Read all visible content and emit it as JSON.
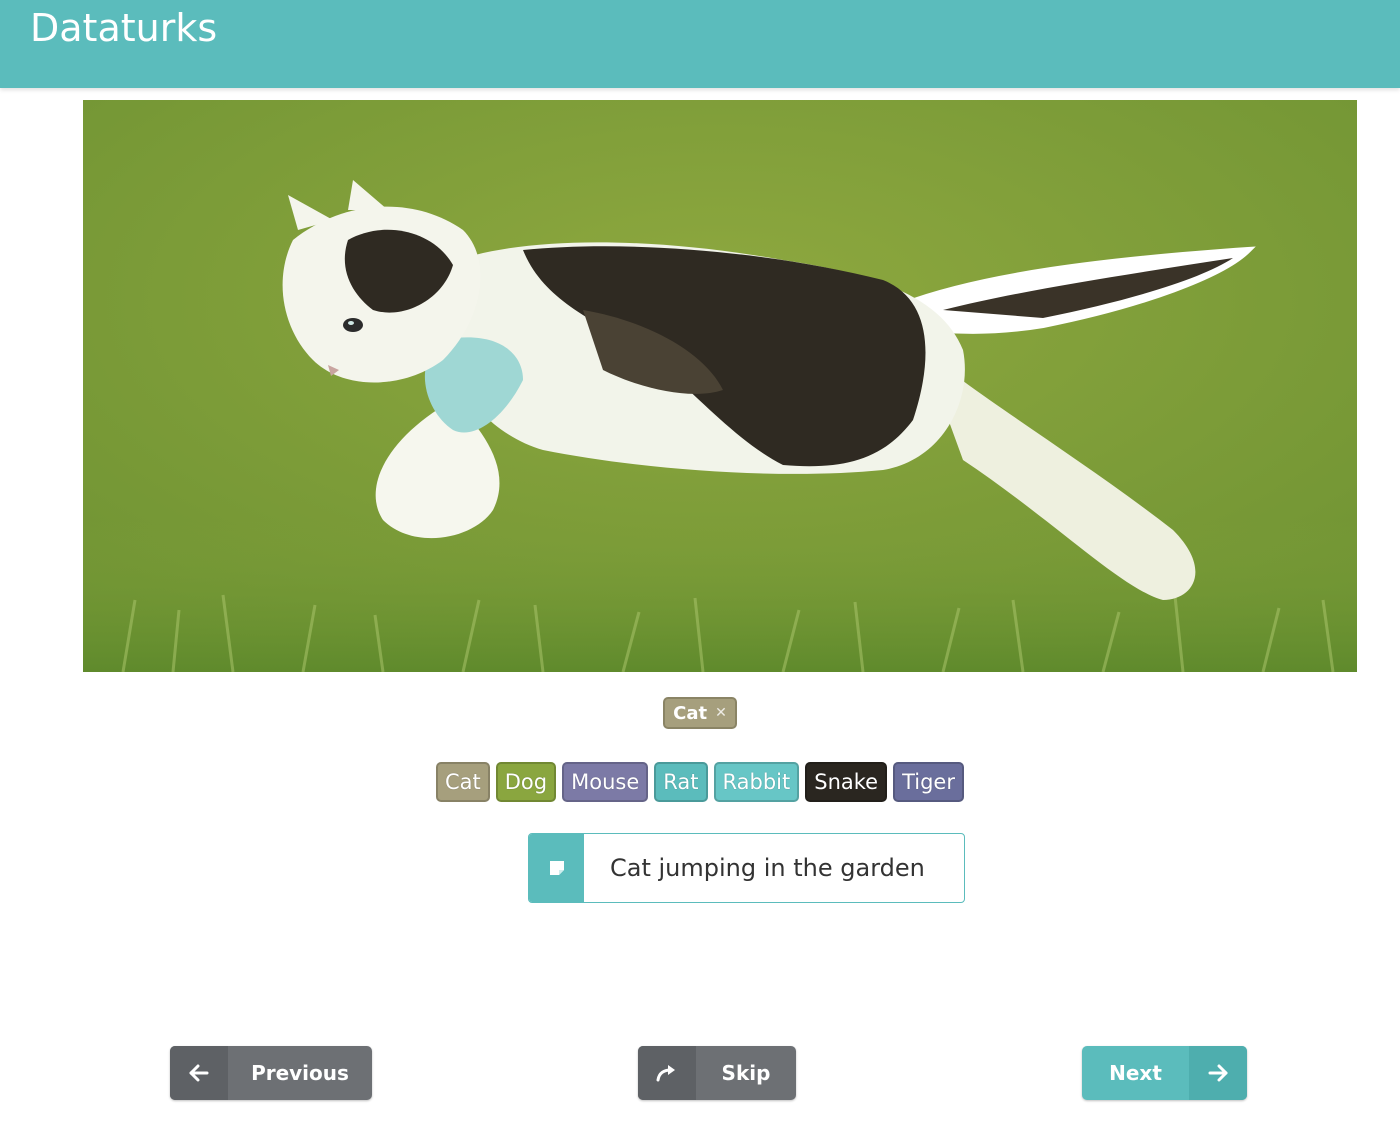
{
  "header": {
    "brand": "Dataturks"
  },
  "image": {
    "subject": "cat"
  },
  "selected_tags": [
    {
      "label": "Cat",
      "color": "#a69f7d"
    }
  ],
  "label_options": [
    {
      "label": "Cat",
      "color": "#a69f7d"
    },
    {
      "label": "Dog",
      "color": "#8aa63f"
    },
    {
      "label": "Mouse",
      "color": "#7c7aa6"
    },
    {
      "label": "Rat",
      "color": "#5bbcbc"
    },
    {
      "label": "Rabbit",
      "color": "#67c6c6"
    },
    {
      "label": "Snake",
      "color": "#2a2620"
    },
    {
      "label": "Tiger",
      "color": "#6a6e9c"
    }
  ],
  "caption": {
    "value": "Cat jumping in the garden",
    "icon": "sticky-note-icon"
  },
  "footer": {
    "previous_label": "Previous",
    "skip_label": "Skip",
    "next_label": "Next"
  }
}
